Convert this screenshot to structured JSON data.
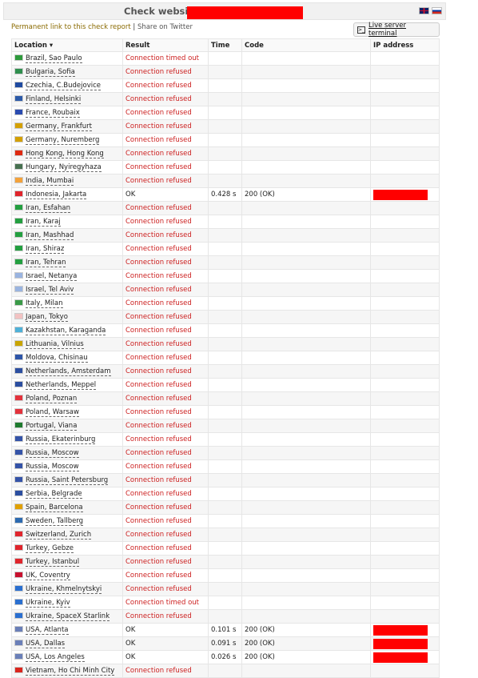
{
  "header": {
    "title": "Check website",
    "permanent_link": "Permanent link to this check report",
    "separator": " | ",
    "share": "Share on Twitter",
    "terminal_label": "Live server terminal"
  },
  "table": {
    "columns": [
      "Location ▾",
      "Result",
      "Time",
      "Code",
      "IP address"
    ],
    "rows": [
      {
        "location": "Brazil, Sao Paulo",
        "result": "Connection timed out",
        "time": "",
        "code": "",
        "flag": "#2e9a3c"
      },
      {
        "location": "Bulgaria, Sofia",
        "result": "Connection refused",
        "time": "",
        "code": "",
        "flag": "#2f8f4e"
      },
      {
        "location": "Czechia, C.Budejovice",
        "result": "Connection refused",
        "time": "",
        "code": "",
        "flag": "#1f4aa0"
      },
      {
        "location": "Finland, Helsinki",
        "result": "Connection refused",
        "time": "",
        "code": "",
        "flag": "#2c5aa8"
      },
      {
        "location": "France, Roubaix",
        "result": "Connection refused",
        "time": "",
        "code": "",
        "flag": "#2a4bb0"
      },
      {
        "location": "Germany, Frankfurt",
        "result": "Connection refused",
        "time": "",
        "code": "",
        "flag": "#d4a000"
      },
      {
        "location": "Germany, Nuremberg",
        "result": "Connection refused",
        "time": "",
        "code": "",
        "flag": "#d4a000"
      },
      {
        "location": "Hong Kong, Hong Kong",
        "result": "Connection refused",
        "time": "",
        "code": "",
        "flag": "#de2910"
      },
      {
        "location": "Hungary, Nyiregyhaza",
        "result": "Connection refused",
        "time": "",
        "code": "",
        "flag": "#477050"
      },
      {
        "location": "India, Mumbai",
        "result": "Connection refused",
        "time": "",
        "code": "",
        "flag": "#f4a23a"
      },
      {
        "location": "Indonesia, Jakarta",
        "result": "OK",
        "time": "0.428 s",
        "code": "200 (OK)",
        "flag": "#e0252c"
      },
      {
        "location": "Iran, Esfahan",
        "result": "Connection refused",
        "time": "",
        "code": "",
        "flag": "#239f40"
      },
      {
        "location": "Iran, Karaj",
        "result": "Connection refused",
        "time": "",
        "code": "",
        "flag": "#239f40"
      },
      {
        "location": "Iran, Mashhad",
        "result": "Connection refused",
        "time": "",
        "code": "",
        "flag": "#239f40"
      },
      {
        "location": "Iran, Shiraz",
        "result": "Connection refused",
        "time": "",
        "code": "",
        "flag": "#239f40"
      },
      {
        "location": "Iran, Tehran",
        "result": "Connection refused",
        "time": "",
        "code": "",
        "flag": "#239f40"
      },
      {
        "location": "Israel, Netanya",
        "result": "Connection refused",
        "time": "",
        "code": "",
        "flag": "#9ab4e0"
      },
      {
        "location": "Israel, Tel Aviv",
        "result": "Connection refused",
        "time": "",
        "code": "",
        "flag": "#9ab4e0"
      },
      {
        "location": "Italy, Milan",
        "result": "Connection refused",
        "time": "",
        "code": "",
        "flag": "#3a9a48"
      },
      {
        "location": "Japan, Tokyo",
        "result": "Connection refused",
        "time": "",
        "code": "",
        "flag": "#f2c2c2"
      },
      {
        "location": "Kazakhstan, Karaganda",
        "result": "Connection refused",
        "time": "",
        "code": "",
        "flag": "#4fb1d8"
      },
      {
        "location": "Lithuania, Vilnius",
        "result": "Connection refused",
        "time": "",
        "code": "",
        "flag": "#c8a400"
      },
      {
        "location": "Moldova, Chisinau",
        "result": "Connection refused",
        "time": "",
        "code": "",
        "flag": "#2d55a8"
      },
      {
        "location": "Netherlands, Amsterdam",
        "result": "Connection refused",
        "time": "",
        "code": "",
        "flag": "#2b4ea0"
      },
      {
        "location": "Netherlands, Meppel",
        "result": "Connection refused",
        "time": "",
        "code": "",
        "flag": "#2b4ea0"
      },
      {
        "location": "Poland, Poznan",
        "result": "Connection refused",
        "time": "",
        "code": "",
        "flag": "#e3323c"
      },
      {
        "location": "Poland, Warsaw",
        "result": "Connection refused",
        "time": "",
        "code": "",
        "flag": "#e3323c"
      },
      {
        "location": "Portugal, Viana",
        "result": "Connection refused",
        "time": "",
        "code": "",
        "flag": "#1e7a2e"
      },
      {
        "location": "Russia, Ekaterinburg",
        "result": "Connection refused",
        "time": "",
        "code": "",
        "flag": "#3453a8"
      },
      {
        "location": "Russia, Moscow",
        "result": "Connection refused",
        "time": "",
        "code": "",
        "flag": "#3453a8"
      },
      {
        "location": "Russia, Moscow",
        "result": "Connection refused",
        "time": "",
        "code": "",
        "flag": "#3453a8"
      },
      {
        "location": "Russia, Saint Petersburg",
        "result": "Connection refused",
        "time": "",
        "code": "",
        "flag": "#3453a8"
      },
      {
        "location": "Serbia, Belgrade",
        "result": "Connection refused",
        "time": "",
        "code": "",
        "flag": "#2b4ea0"
      },
      {
        "location": "Spain, Barcelona",
        "result": "Connection refused",
        "time": "",
        "code": "",
        "flag": "#e0a000"
      },
      {
        "location": "Sweden, Tallberg",
        "result": "Connection refused",
        "time": "",
        "code": "",
        "flag": "#2c6ab0"
      },
      {
        "location": "Switzerland, Zurich",
        "result": "Connection refused",
        "time": "",
        "code": "",
        "flag": "#e0252c"
      },
      {
        "location": "Turkey, Gebze",
        "result": "Connection refused",
        "time": "",
        "code": "",
        "flag": "#e0252c"
      },
      {
        "location": "Turkey, Istanbul",
        "result": "Connection refused",
        "time": "",
        "code": "",
        "flag": "#e0252c"
      },
      {
        "location": "UK, Coventry",
        "result": "Connection refused",
        "time": "",
        "code": "",
        "flag": "#c8102e"
      },
      {
        "location": "Ukraine, Khmelnytskyi",
        "result": "Connection refused",
        "time": "",
        "code": "",
        "flag": "#2a6fd0"
      },
      {
        "location": "Ukraine, Kyiv",
        "result": "Connection timed out",
        "time": "",
        "code": "",
        "flag": "#2a6fd0"
      },
      {
        "location": "Ukraine, SpaceX Starlink",
        "result": "Connection refused",
        "time": "",
        "code": "",
        "flag": "#2a6fd0"
      },
      {
        "location": "USA, Atlanta",
        "result": "OK",
        "time": "0.101 s",
        "code": "200 (OK)",
        "flag": "#6a7fb8"
      },
      {
        "location": "USA, Dallas",
        "result": "OK",
        "time": "0.091 s",
        "code": "200 (OK)",
        "flag": "#6a7fb8"
      },
      {
        "location": "USA, Los Angeles",
        "result": "OK",
        "time": "0.026 s",
        "code": "200 (OK)",
        "flag": "#6a7fb8"
      },
      {
        "location": "Vietnam, Ho Chi Minh City",
        "result": "Connection refused",
        "time": "",
        "code": "",
        "flag": "#da251d"
      }
    ]
  },
  "colors": {
    "refused": "#cc1f1f",
    "redaction": "#ff0000",
    "link": "#8a6a00"
  }
}
